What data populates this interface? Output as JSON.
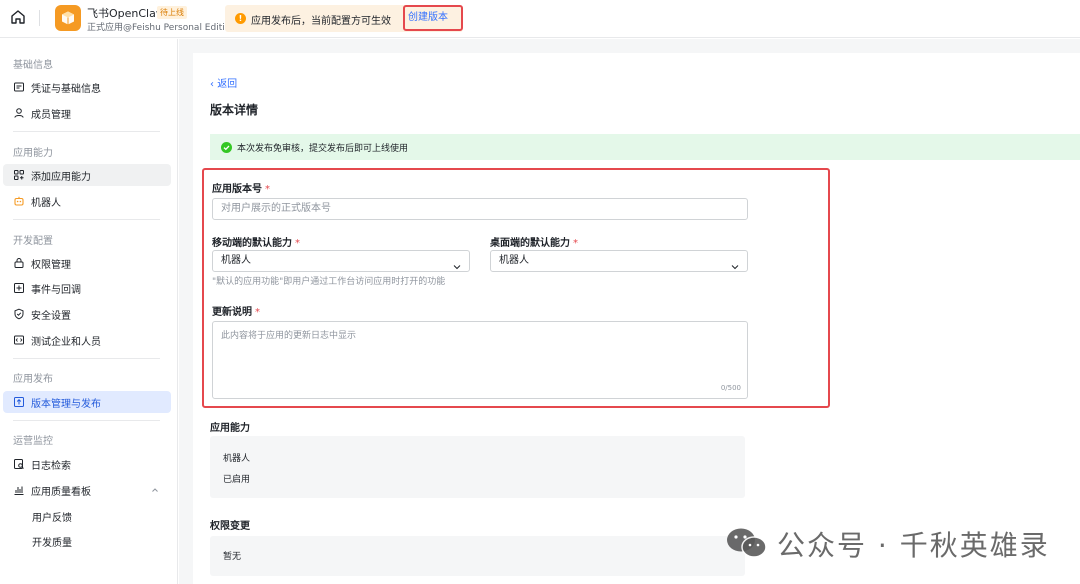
{
  "topbar": {
    "app_name": "飞书OpenClaw",
    "status_tag": "待上线",
    "app_subtitle": "正式应用@Feishu Personal Edition",
    "notice": "应用发布后，当前配置方可生效",
    "create_version": "创建版本"
  },
  "sidebar": {
    "sections": [
      {
        "title": "基础信息"
      },
      {
        "title": "应用能力"
      },
      {
        "title": "开发配置"
      },
      {
        "title": "应用发布"
      },
      {
        "title": "运营监控"
      }
    ],
    "items": {
      "credentials": "凭证与基础信息",
      "members": "成员管理",
      "add_capability": "添加应用能力",
      "bot": "机器人",
      "permissions": "权限管理",
      "events": "事件与回调",
      "security": "安全设置",
      "test_org": "测试企业和人员",
      "versions": "版本管理与发布",
      "logs": "日志检索",
      "quality": "应用质量看板",
      "feedback": "用户反馈",
      "dev_quality": "开发质量"
    }
  },
  "main": {
    "back": "返回",
    "title": "版本详情",
    "success_notice": "本次发布免审核，提交发布后即可上线使用",
    "form": {
      "version_label": "应用版本号",
      "version_placeholder": "对用户展示的正式版本号",
      "mobile_label": "移动端的默认能力",
      "mobile_value": "机器人",
      "desktop_label": "桌面端的默认能力",
      "desktop_value": "机器人",
      "default_hint": "\"默认的应用功能\"即用户通过工作台访问应用时打开的功能",
      "notes_label": "更新说明",
      "notes_placeholder": "此内容将于应用的更新日志中显示",
      "notes_counter": "0/500",
      "required_mark": "*"
    },
    "capabilities": {
      "label": "应用能力",
      "name": "机器人",
      "status": "已启用"
    },
    "permissions": {
      "label": "权限变更",
      "value": "暂无"
    }
  },
  "watermark": "公众号 · 千秋英雄录",
  "colors": {
    "accent": "#3370ff",
    "highlight_border": "#e5484d",
    "success_bg": "#e4f8e9",
    "notice_bg": "#fdf1e1",
    "logo": "#f59a23"
  }
}
